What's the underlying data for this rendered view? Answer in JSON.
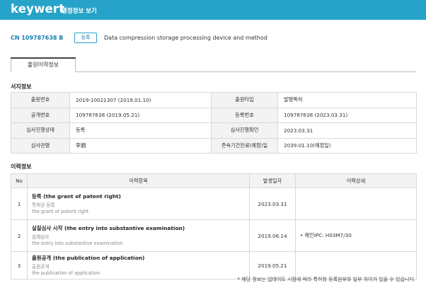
{
  "header": {
    "logo": "keywert",
    "title": "행정정보 보기"
  },
  "patent": {
    "number": "CN 109787638 B",
    "status": "등록",
    "title": "Data compression storage processing device and method"
  },
  "tabs": [
    {
      "label": "출원이력정보"
    }
  ],
  "biblio": {
    "section_title": "서지정보",
    "rows": [
      {
        "l1": "출원번호",
        "v1": "2019-10021307 (2019.01.10)",
        "l2": "출원타입",
        "v2": "발명특허"
      },
      {
        "l1": "공개번호",
        "v1": "109787638 (2019.05.21)",
        "l2": "등록번호",
        "v2": "109787638 (2023.03.31)"
      },
      {
        "l1": "심사진행상태",
        "v1": "등록",
        "l2": "심사진행확인",
        "v2": "2023.03.31"
      },
      {
        "l1": "심사관명",
        "v1": "李娟",
        "l2": "존속기간만료(예정)일",
        "v2": "2039.01.10(예정일)"
      }
    ]
  },
  "history": {
    "section_title": "이력정보",
    "columns": [
      "No",
      "이력항목",
      "발생일자",
      "이력상세"
    ],
    "rows": [
      {
        "no": "1",
        "main": "등록 (the grant of patent right)",
        "sub1": "특허권 등록",
        "sub2": "the grant of patent right",
        "date": "2023.03.31",
        "detail": ""
      },
      {
        "no": "2",
        "main": "실질심사 시작 (the entry into substantive examination)",
        "sub1": "실체심사",
        "sub2": "the entry into substantive examination",
        "date": "2019.06.14",
        "detail": "• 메인IPC: H03M7/30"
      },
      {
        "no": "3",
        "main": "출원공개 (the publication of application)",
        "sub1": "출원공개",
        "sub2": "the publication of application",
        "date": "2019.05.21",
        "detail": ""
      }
    ]
  },
  "footnote": "* 해당 정보는 업데이트 시점에 따라 특허청 등록원부와 일부 차이가 있을 수 있습니다."
}
